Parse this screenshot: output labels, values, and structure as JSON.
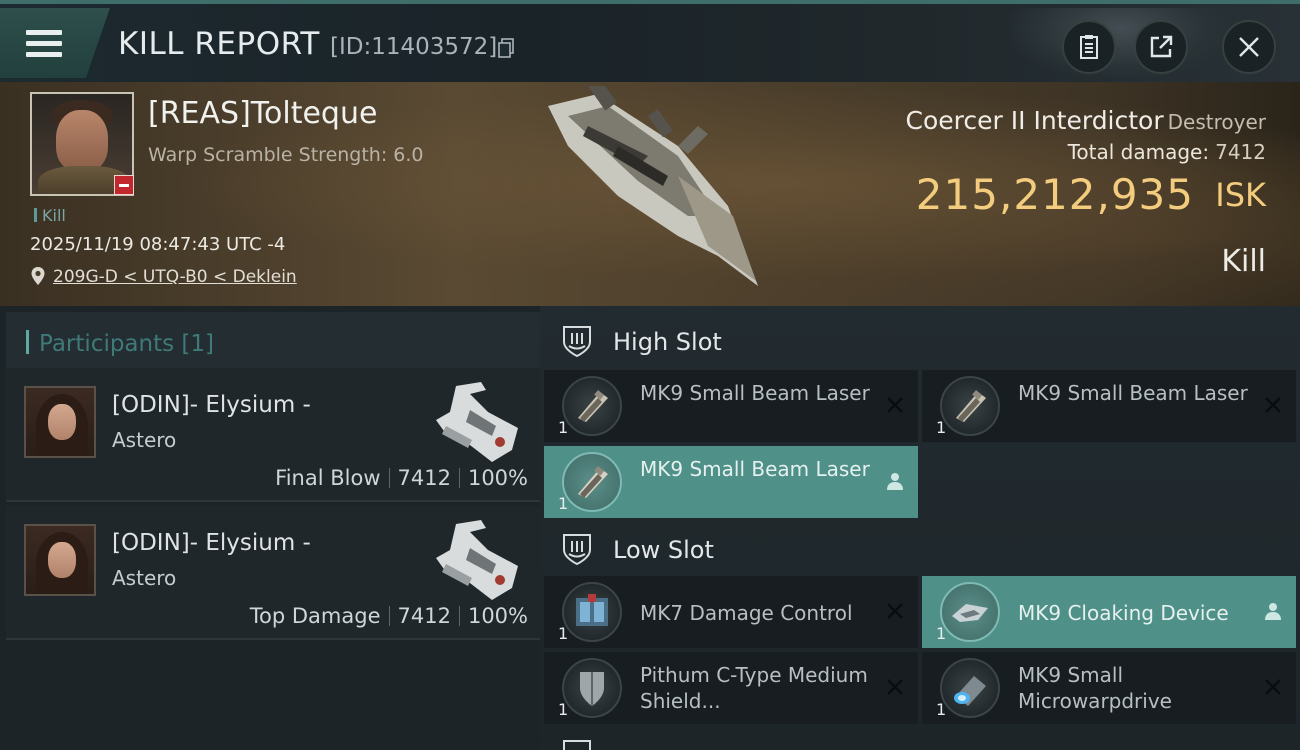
{
  "header": {
    "title": "KILL REPORT",
    "report_id": "[ID:11403572]"
  },
  "victim": {
    "name": "[REAS]Tolteque",
    "warp_scramble": "Warp Scramble Strength: 6.0",
    "tag": "Kill",
    "timestamp": "2025/11/19 08:47:43 UTC -4",
    "location": "209G-D < UTQ-B0 < Deklein",
    "ship_name": "Coercer II Interdictor",
    "ship_class": "Destroyer",
    "total_damage_label": "Total damage:",
    "total_damage_value": "7412",
    "isk_value": "215,212,935",
    "isk_unit": "ISK",
    "result": "Kill"
  },
  "participants": {
    "title": "Participants [1]",
    "items": [
      {
        "name": "[ODIN]- Elysium -",
        "ship": "Astero",
        "role": "Final Blow",
        "damage": "7412",
        "percent": "100%"
      },
      {
        "name": "[ODIN]- Elysium -",
        "ship": "Astero",
        "role": "Top Damage",
        "damage": "7412",
        "percent": "100%"
      }
    ]
  },
  "fitting": {
    "high_slot": {
      "title": "High Slot",
      "modules": [
        {
          "name": "MK9 Small Beam Laser",
          "qty": "1",
          "status": "destroyed"
        },
        {
          "name": "MK9 Small Beam Laser",
          "qty": "1",
          "status": "destroyed"
        },
        {
          "name": "MK9 Small Beam Laser",
          "qty": "1",
          "status": "dropped"
        }
      ]
    },
    "low_slot": {
      "title": "Low Slot",
      "modules": [
        {
          "name": "MK7 Damage Control",
          "qty": "1",
          "status": "destroyed"
        },
        {
          "name": "MK9 Cloaking Device",
          "qty": "1",
          "status": "dropped"
        },
        {
          "name": "Pithum C-Type Medium Shield...",
          "qty": "1",
          "status": "destroyed"
        },
        {
          "name": "MK9 Small Microwarpdrive",
          "qty": "1",
          "status": "destroyed"
        }
      ]
    }
  },
  "colors": {
    "accent": "#4f9089",
    "isk_gold": "#f3cd7d",
    "loss_red": "#c1272d"
  },
  "icons": [
    "menu-icon",
    "copy-icon",
    "clipboard-icon",
    "share-icon",
    "close-icon",
    "location-pin-icon",
    "slot-shield-icon",
    "destroyed-x-icon",
    "dropped-person-icon"
  ]
}
